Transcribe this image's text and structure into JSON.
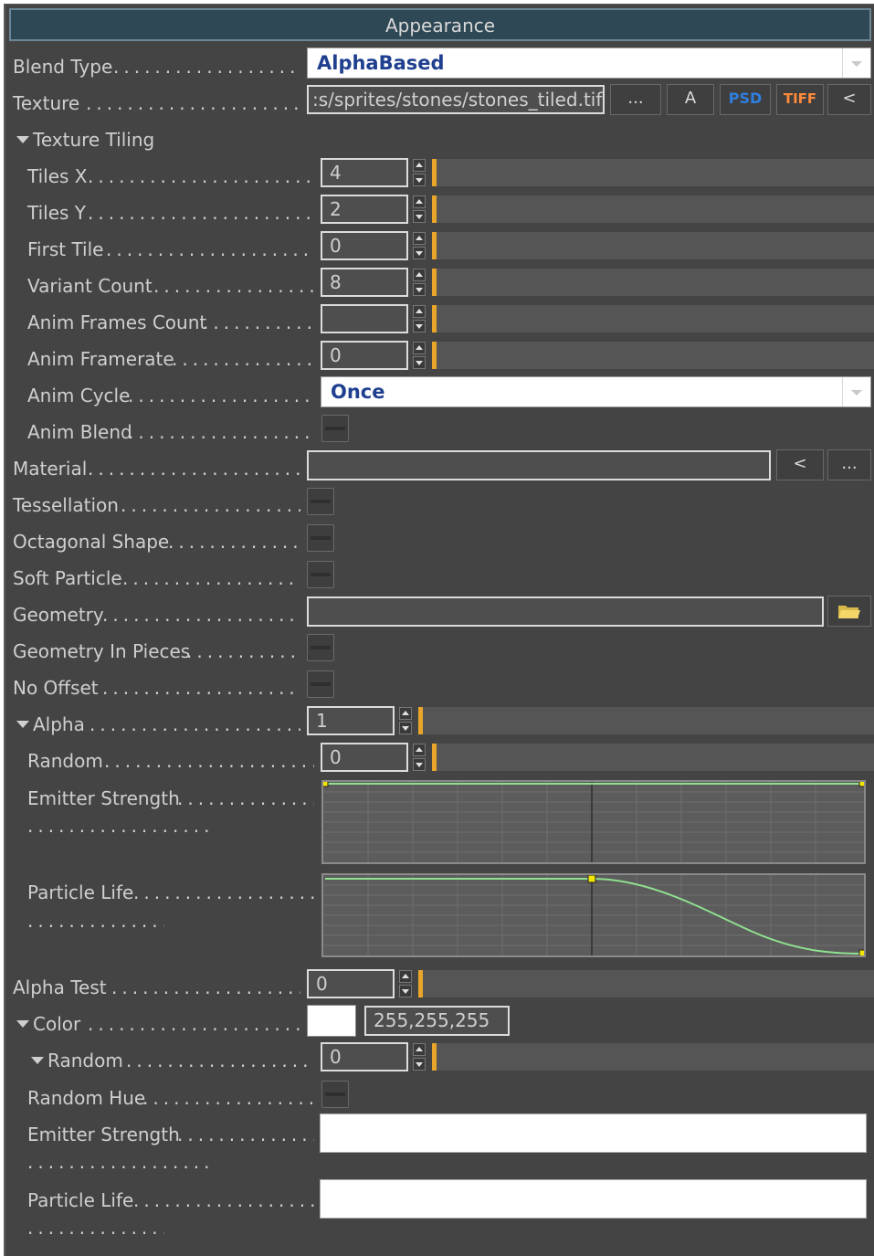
{
  "panel": {
    "title": "Appearance"
  },
  "blend_type": {
    "label": "Blend Type",
    "value": "AlphaBased"
  },
  "texture": {
    "label": "Texture",
    "value": ":s/sprites/stones/stones_tiled.tif",
    "buttons": {
      "browse": "...",
      "a": "A",
      "psd": "PSD",
      "tiff": "TIFF",
      "back": "<"
    }
  },
  "texture_tiling": {
    "label": "Texture Tiling",
    "tiles_x": {
      "label": "Tiles X",
      "value": "4"
    },
    "tiles_y": {
      "label": "Tiles Y",
      "value": "2"
    },
    "first_tile": {
      "label": "First Tile",
      "value": "0"
    },
    "variant_count": {
      "label": "Variant Count",
      "value": "8"
    },
    "anim_frames_count": {
      "label": "Anim Frames Count",
      "value": ""
    },
    "anim_framerate": {
      "label": "Anim Framerate",
      "value": "0"
    },
    "anim_cycle": {
      "label": "Anim Cycle",
      "value": "Once"
    },
    "anim_blend": {
      "label": "Anim Blend",
      "checked": false
    }
  },
  "material": {
    "label": "Material",
    "value": "",
    "buttons": {
      "back": "<",
      "browse": "..."
    }
  },
  "tessellation": {
    "label": "Tessellation",
    "checked": false
  },
  "octagonal_shape": {
    "label": "Octagonal Shape",
    "checked": false
  },
  "soft_particle": {
    "label": "Soft Particle",
    "checked": false
  },
  "geometry": {
    "label": "Geometry",
    "value": ""
  },
  "geometry_in_pieces": {
    "label": "Geometry In Pieces",
    "checked": false
  },
  "no_offset": {
    "label": "No Offset",
    "checked": false
  },
  "alpha": {
    "label": "Alpha",
    "value": "1",
    "random": {
      "label": "Random",
      "value": "0"
    },
    "emitter_strength": {
      "label": "Emitter Strength"
    },
    "particle_life": {
      "label": "Particle Life"
    }
  },
  "alpha_test": {
    "label": "Alpha Test",
    "value": "0"
  },
  "color": {
    "label": "Color",
    "value": "255,255,255",
    "swatch": "#ffffff",
    "random": {
      "label": "Random",
      "value": "0"
    },
    "random_hue": {
      "label": "Random Hue",
      "checked": false
    },
    "emitter_strength": {
      "label": "Emitter Strength"
    },
    "particle_life": {
      "label": "Particle Life"
    }
  },
  "colors": {
    "panel_bg": "#444444",
    "header_bg": "#2f4855",
    "accent": "#e8a52a",
    "curve": "#8fe08f",
    "key": "#f2e600",
    "dropdown_text": "#1f3f8f"
  },
  "icons": {
    "folder": "folder-open-icon",
    "expand": "triangle-down-icon"
  }
}
